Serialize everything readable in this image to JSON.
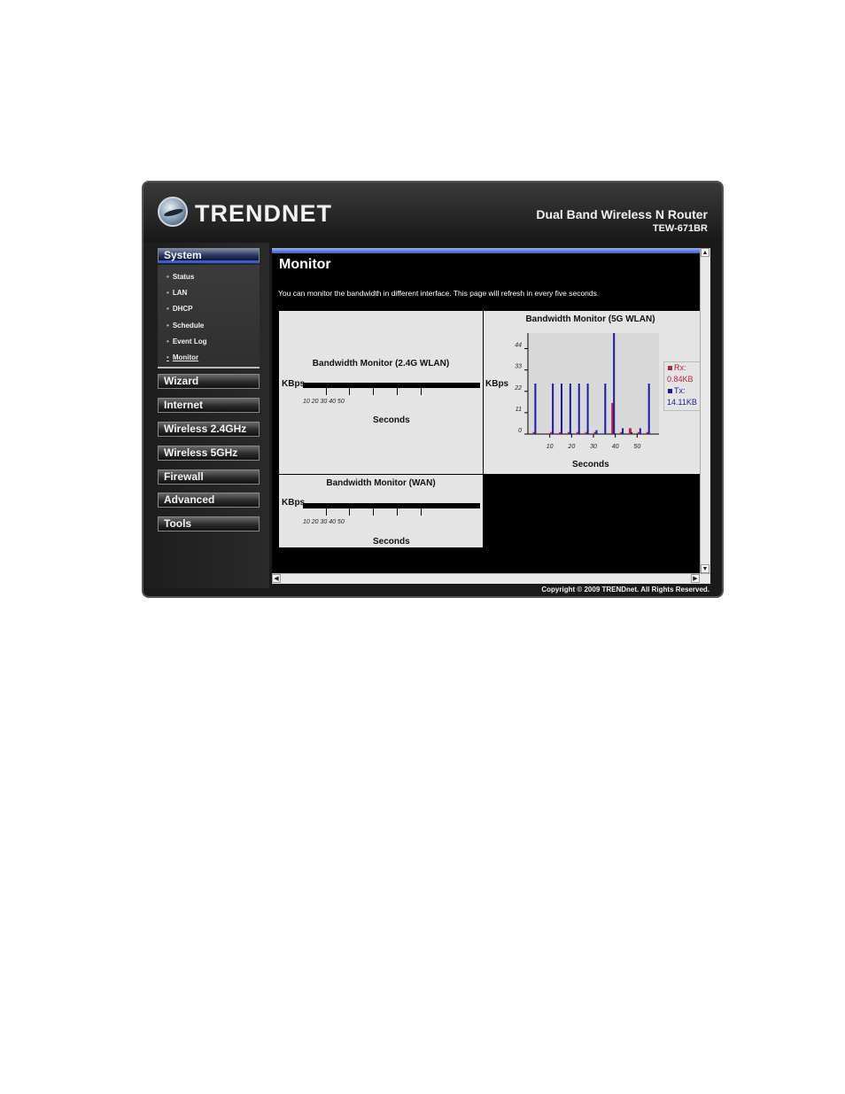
{
  "header": {
    "brand": "TRENDNET",
    "product": "Dual Band Wireless N Router",
    "model": "TEW-671BR"
  },
  "sidebar": {
    "system": "System",
    "sub_items": [
      {
        "label": "Status"
      },
      {
        "label": "LAN"
      },
      {
        "label": "DHCP"
      },
      {
        "label": "Schedule"
      },
      {
        "label": "Event Log"
      },
      {
        "label": "Monitor"
      }
    ],
    "menus": [
      "Wizard",
      "Internet",
      "Wireless 2.4GHz",
      "Wireless 5GHz",
      "Firewall",
      "Advanced",
      "Tools"
    ]
  },
  "main": {
    "title": "Monitor",
    "description": "You can monitor the bandwidth in different interface. This page will refresh in every five seconds.",
    "wlan24": {
      "title": "Bandwidth Monitor (2.4G WLAN)",
      "ylabel": "KBps",
      "xlabel": "Seconds",
      "ticks": "10 20 30 40 50"
    },
    "wan": {
      "title": "Bandwidth Monitor (WAN)",
      "ylabel": "KBps",
      "xlabel": "Seconds",
      "ticks": "10 20 30 40 50"
    },
    "wlan5": {
      "title": "Bandwidth Monitor (5G WLAN)",
      "ylabel": "KBps",
      "xlabel": "Seconds",
      "rx_label": "Rx:",
      "rx_value": "0.84KB",
      "tx_label": "Tx:",
      "tx_value": "14.11KB"
    }
  },
  "footer": {
    "copyright": "Copyright © 2009 TRENDnet. All Rights Reserved."
  },
  "chart_data": {
    "type": "bar",
    "title": "Bandwidth Monitor (5G WLAN)",
    "xlabel": "Seconds",
    "ylabel": "KBps",
    "x_ticks": [
      10,
      20,
      30,
      40,
      50
    ],
    "y_ticks": [
      0,
      11,
      22,
      33,
      44
    ],
    "xlim": [
      0,
      60
    ],
    "ylim": [
      0,
      52
    ],
    "x": [
      3,
      7,
      11,
      15,
      19,
      23,
      27,
      31,
      35,
      39,
      43,
      47,
      51,
      55
    ],
    "series": [
      {
        "name": "Rx",
        "color": "#c0203a",
        "values": [
          1,
          0,
          1,
          1,
          1,
          1,
          1,
          1,
          0,
          16,
          1,
          3,
          1,
          1
        ]
      },
      {
        "name": "Tx",
        "color": "#1a1aa8",
        "values": [
          26,
          0,
          26,
          26,
          26,
          26,
          26,
          2,
          26,
          52,
          3,
          1,
          3,
          26
        ]
      }
    ]
  }
}
